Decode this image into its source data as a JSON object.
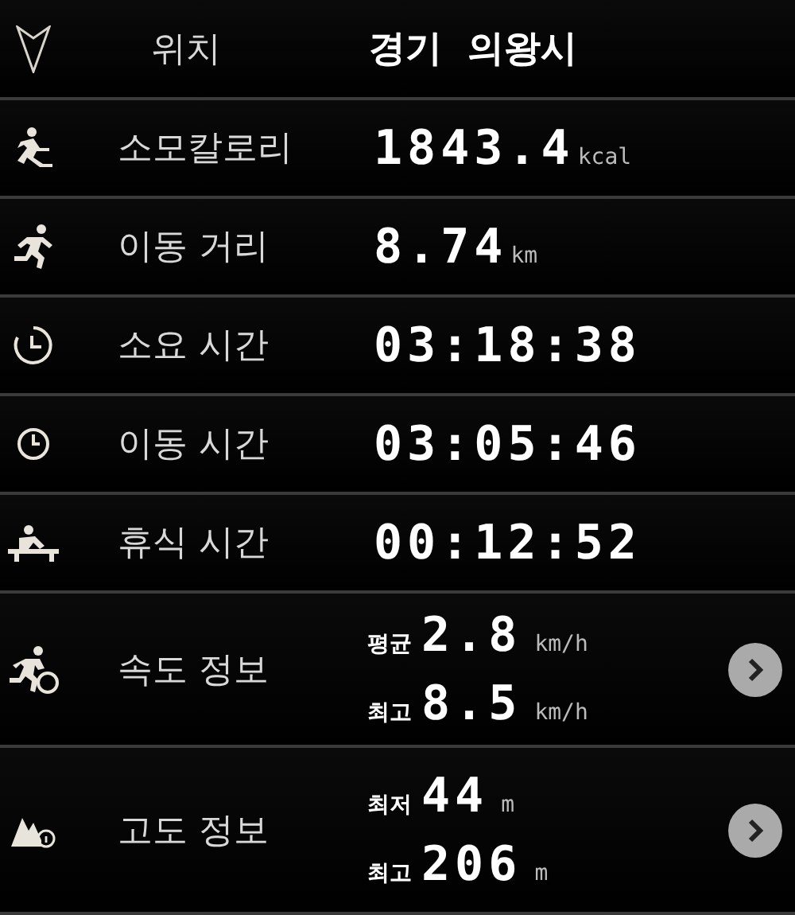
{
  "rows": [
    {
      "kind": "location",
      "label": "위치",
      "value": "경기  의왕시"
    },
    {
      "kind": "single",
      "label": "소모칼로리",
      "value": "1843.4",
      "unit": "kcal"
    },
    {
      "kind": "single",
      "label": "이동 거리",
      "value": "8.74",
      "unit": "km"
    },
    {
      "kind": "single",
      "label": "소요 시간",
      "value": "03:18:38"
    },
    {
      "kind": "single",
      "label": "이동 시간",
      "value": "03:05:46"
    },
    {
      "kind": "single",
      "label": "휴식 시간",
      "value": "00:12:52"
    },
    {
      "kind": "double",
      "label": "속도 정보",
      "lines": [
        {
          "prefix": "평균",
          "value": "2.8",
          "unit": "km/h"
        },
        {
          "prefix": "최고",
          "value": "8.5",
          "unit": "km/h"
        }
      ]
    },
    {
      "kind": "double",
      "label": "고도 정보",
      "lines": [
        {
          "prefix": "최저",
          "value": "44",
          "unit": "m"
        },
        {
          "prefix": "최고",
          "value": "206",
          "unit": "m"
        }
      ]
    }
  ]
}
